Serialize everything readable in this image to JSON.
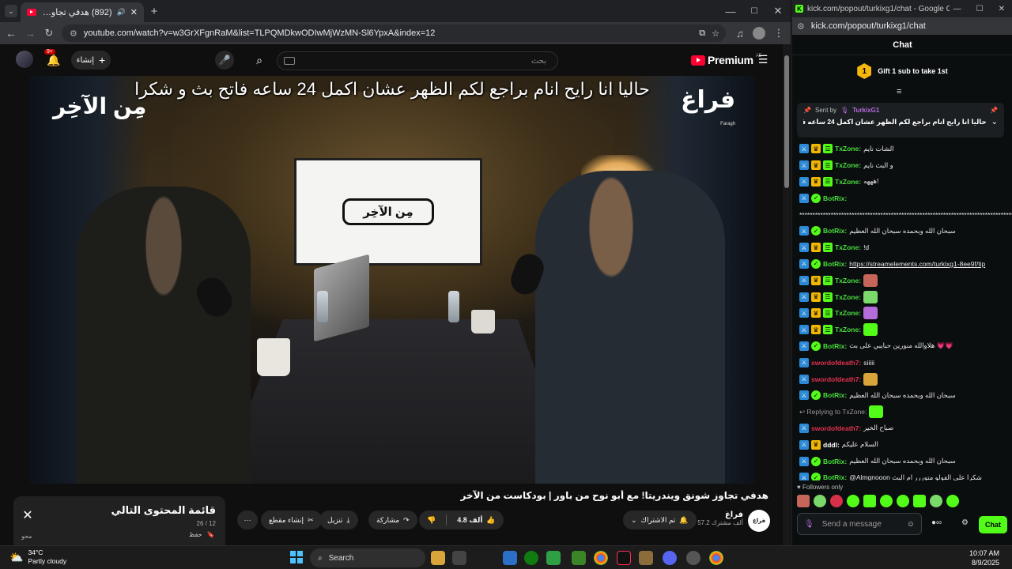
{
  "youtube_browser": {
    "tab_title": "(892) هدفي تجاوز شونق وند...",
    "url": "youtube.com/watch?v=w3GrXFgnRaM&list=TLPQMDkwODIwMjWzMN-Sl6YpxA&index=12",
    "search_placeholder": "بحث",
    "create_label": "إنشاء",
    "notif_count": "9+",
    "logo_text": "Premium",
    "logo_region": "AE"
  },
  "video": {
    "subtitle": "حاليا انا رايح انام براجع لكم الظهر عشان اكمل 24 ساعه فاتح بث و شكرا",
    "brand_right": "فراغ",
    "brand_right_small": "Faragh",
    "brand_left": "مِن الآخِر",
    "tv_logo": "مِن الآخِر",
    "title": "هدفي تجاوز شونق ويندريتا! مع أبو نوح من باور | بودكاست من الآخر",
    "channel_name": "فراغ",
    "channel_subs": "57.2 ألف مشترك",
    "channel_avatar": "فراغ",
    "subscribe_label": "تم الاشتراك",
    "likes": "4.8 ألف",
    "share_label": "مشاركة",
    "download_label": "تنزيل",
    "clip_label": "إنشاء مقطع",
    "more_label": "···"
  },
  "playlist": {
    "title": "قائمة المحتوى التالي",
    "position": "26 / 12",
    "save_label": "حفظ",
    "owner": "محو"
  },
  "kick": {
    "window_title": "kick.com/popout/turkixg1/chat - Google Chro...",
    "url": "kick.com/popout/turkixg1/chat",
    "header": "Chat",
    "gift_number": "1",
    "gift_text": "Gift 1 sub to take 1st",
    "pinned": {
      "sent_by_label": "Sent by",
      "sender": "TurkixG1",
      "text": "حاليا انا رايح انام براجع لكم الظهر عشان اكمل 24 ساعه فاتح بث و شكرا"
    },
    "messages": [
      {
        "user": "TxZone:",
        "color": "#4ade3f",
        "badges": [
          "mod",
          "crown",
          "sub"
        ],
        "text": "الشات نايم"
      },
      {
        "user": "TxZone:",
        "color": "#4ade3f",
        "badges": [
          "mod",
          "crown",
          "sub"
        ],
        "text": "و البث نايم"
      },
      {
        "user": "TxZone:",
        "color": "#4ade3f",
        "badges": [
          "mod",
          "crown",
          "sub"
        ],
        "text": "هههه!"
      },
      {
        "user": "BotRix:",
        "color": "#4ade3f",
        "badges": [
          "mod",
          "ver"
        ],
        "text": ""
      },
      {
        "user": "",
        "color": "#4ade3f",
        "badges": [],
        "text": "**********************************************************************************************"
      },
      {
        "user": "BotRix:",
        "color": "#4ade3f",
        "badges": [
          "mod",
          "ver"
        ],
        "text": "سبحان الله وبحمده سبحان الله العظيم"
      },
      {
        "user": "TxZone:",
        "color": "#4ade3f",
        "badges": [
          "mod",
          "crown",
          "sub"
        ],
        "text": "!d"
      },
      {
        "user": "BotRix:",
        "color": "#4ade3f",
        "badges": [
          "mod",
          "ver"
        ],
        "text": "https://streamelements.com/turkixg1-8ee9f/tip"
      },
      {
        "user": "TxZone:",
        "color": "#4ade3f",
        "badges": [
          "mod",
          "crown",
          "sub"
        ],
        "text": "",
        "emote": "#c6665a"
      },
      {
        "user": "TxZone:",
        "color": "#4ade3f",
        "badges": [
          "mod",
          "crown",
          "sub"
        ],
        "text": "",
        "emote": "#7bd86a"
      },
      {
        "user": "TxZone:",
        "color": "#4ade3f",
        "badges": [
          "mod",
          "crown",
          "sub"
        ],
        "text": "",
        "emote": "#b56bd9"
      },
      {
        "user": "TxZone:",
        "color": "#4ade3f",
        "badges": [
          "mod",
          "crown",
          "sub"
        ],
        "text": "",
        "emote": "#53fc18"
      },
      {
        "user": "BotRix:",
        "color": "#4ade3f",
        "badges": [
          "mod",
          "ver"
        ],
        "text": "هلاوالله منورين حبايبي على بث 💗💗"
      },
      {
        "user": "swordofdeath7:",
        "color": "#e0314f",
        "badges": [
          "mod"
        ],
        "text": "siiiii"
      },
      {
        "user": "swordofdeath7:",
        "color": "#e0314f",
        "badges": [
          "mod"
        ],
        "text": "",
        "emote": "#d9a53a"
      },
      {
        "user": "BotRix:",
        "color": "#4ade3f",
        "badges": [
          "mod",
          "ver"
        ],
        "text": "سبحان الله وبحمده سبحان الله العظيم"
      },
      {
        "user": "",
        "color": "#9a9a9a",
        "badges": [],
        "text": "↩ Replying to TxZone:",
        "emote": "#53fc18",
        "reply": true
      },
      {
        "user": "swordofdeath7:",
        "color": "#e0314f",
        "badges": [
          "mod"
        ],
        "text": "صباح الخير"
      },
      {
        "user": "dddl:",
        "color": "#ffffff",
        "badges": [
          "mod",
          "crown"
        ],
        "text": "السلام عليكم"
      },
      {
        "user": "BotRix:",
        "color": "#4ade3f",
        "badges": [
          "mod",
          "ver"
        ],
        "text": "سبحان الله وبحمده سبحان الله العظيم"
      },
      {
        "user": "BotRix:",
        "color": "#4ade3f",
        "badges": [
          "mod",
          "ver"
        ],
        "text": "@Almgnooon شكرا على الفولو متوررر ام البث"
      }
    ],
    "followers_only": "Followers only",
    "send_placeholder": "Send a message",
    "chat_button": "Chat"
  },
  "taskbar": {
    "weather_temp": "34°C",
    "weather_desc": "Partly cloudy",
    "search_label": "Search",
    "time": "10:07 AM",
    "date": "8/9/2025"
  }
}
